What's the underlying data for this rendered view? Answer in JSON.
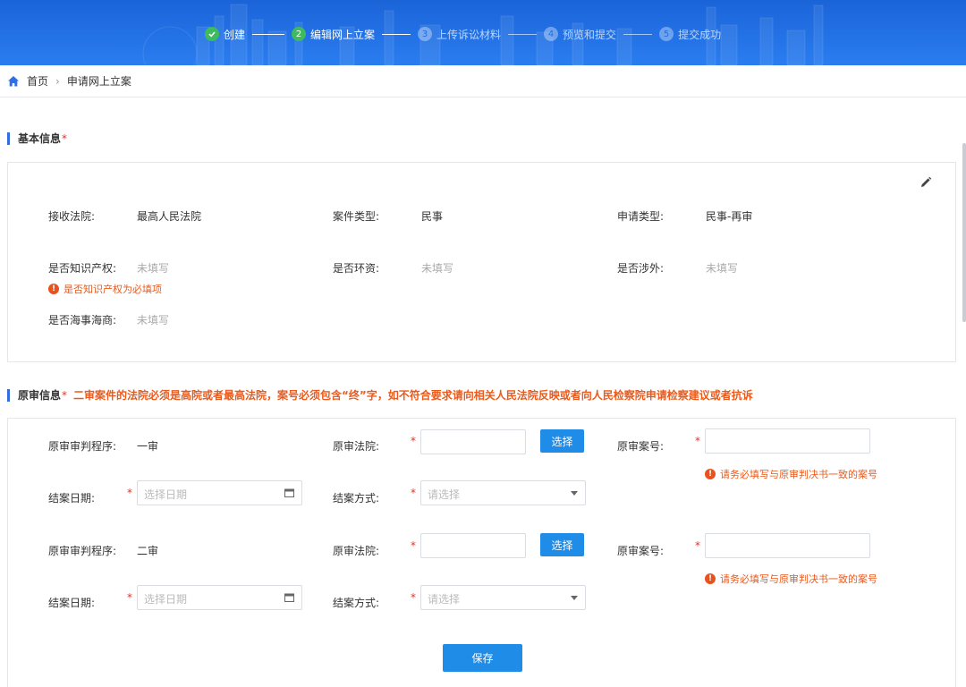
{
  "steps": [
    {
      "num": "",
      "label": "创建",
      "state": "done"
    },
    {
      "num": "2",
      "label": "编辑网上立案",
      "state": "active"
    },
    {
      "num": "3",
      "label": "上传诉讼材料",
      "state": "todo"
    },
    {
      "num": "4",
      "label": "预览和提交",
      "state": "todo"
    },
    {
      "num": "5",
      "label": "提交成功",
      "state": "todo"
    }
  ],
  "breadcrumb": {
    "home": "首页",
    "current": "申请网上立案"
  },
  "basic": {
    "title": "基本信息",
    "required_mark": "*",
    "court_label": "接收法院:",
    "court_value": "最高人民法院",
    "case_type_label": "案件类型:",
    "case_type_value": "民事",
    "apply_type_label": "申请类型:",
    "apply_type_value": "民事-再审",
    "ip_label": "是否知识产权:",
    "ip_value": "未填写",
    "env_label": "是否环资:",
    "env_value": "未填写",
    "foreign_label": "是否涉外:",
    "foreign_value": "未填写",
    "ip_error": "是否知识产权为必填项",
    "maritime_label": "是否海事海商:",
    "maritime_value": "未填写"
  },
  "original": {
    "title": "原审信息",
    "required_mark": "*",
    "note": "二审案件的法院必须是高院或者最高法院，案号必须包含“终”字，如不符合要求请向相关人民法院反映或者向人民检察院申请检察建议或者抗诉",
    "rows": [
      {
        "procedure_label": "原审审判程序:",
        "procedure_value": "一审",
        "court_label": "原审法院:",
        "choose_label": "选择",
        "case_no_label": "原审案号:",
        "case_no_error": "请务必填写与原审判决书一致的案号",
        "close_date_label": "结案日期:",
        "close_date_placeholder": "选择日期",
        "close_method_label": "结案方式:",
        "close_method_placeholder": "请选择"
      },
      {
        "procedure_label": "原审审判程序:",
        "procedure_value": "二审",
        "court_label": "原审法院:",
        "choose_label": "选择",
        "case_no_label": "原审案号:",
        "case_no_error": "请务必填写与原审判决书一致的案号",
        "close_date_label": "结案日期:",
        "close_date_placeholder": "选择日期",
        "close_method_label": "结案方式:",
        "close_method_placeholder": "请选择"
      }
    ],
    "star": "*",
    "error_icon": "!"
  },
  "save_label": "保存",
  "colors": {
    "primary": "#1f8ce8",
    "banner": "#1a64d8",
    "success": "#3dbb5e",
    "warning": "#ea5a1c",
    "required": "#e0352b"
  },
  "icons": {
    "home": "home-icon",
    "edit": "pencil-icon",
    "check": "check-icon",
    "calendar": "calendar-icon",
    "caret": "caret-down-icon",
    "error": "exclamation-circle-icon"
  }
}
